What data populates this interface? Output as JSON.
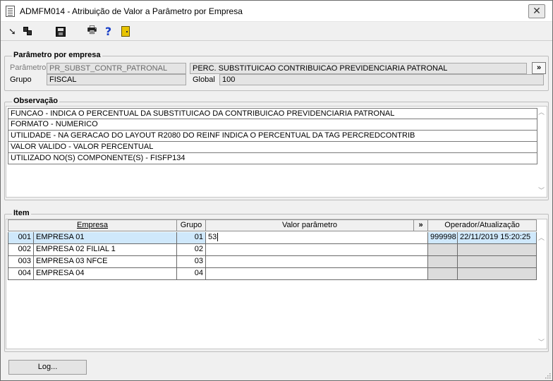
{
  "window": {
    "title": "ADMFM014 - Atribuição de Valor a Parâmetro por Empresa",
    "close_label": "✕"
  },
  "toolbar": {
    "icons": [
      "arrow-icon",
      "copy-icon",
      "save-icon",
      "print-icon",
      "help-icon",
      "exit-icon"
    ],
    "help_glyph": "?"
  },
  "parametro_grupo": {
    "legend": "Parâmetro por empresa",
    "parametro_label": "Parâmetro",
    "parametro_code": "PR_SUBST_CONTR_PATRONAL",
    "parametro_desc": "PERC. SUBSTITUICAO CONTRIBUICAO PREVIDENCIARIA PATRONAL",
    "more_label": "»",
    "grupo_label": "Grupo",
    "grupo_value": "FISCAL",
    "global_label": "Global",
    "global_value": "100"
  },
  "observacao": {
    "legend": "Observação",
    "lines": [
      "FUNCAO - INDICA O PERCENTUAL DA SUBSTITUICAO DA CONTRIBUICAO PREVIDENCIARIA PATRONAL",
      "FORMATO - NUMERICO",
      "UTILIDADE -  NA GERACAO DO LAYOUT R2080 DO REINF INDICA O PERCENTUAL DA TAG PERCREDCONTRIB",
      "VALOR VALIDO - VALOR PERCENTUAL",
      "UTILIZADO NO(S) COMPONENTE(S) - FISFP134"
    ]
  },
  "item": {
    "legend": "Item",
    "headers": {
      "empresa": "Empresa",
      "grupo": "Grupo",
      "valor": "Valor parâmetro",
      "more": "»",
      "operador": "Operador/Atualização"
    },
    "rows": [
      {
        "code": "001",
        "name": "EMPRESA 01",
        "grupo": "01",
        "valor": "53",
        "operador": "999998",
        "atualizacao": "22/11/2019 15:20:25"
      },
      {
        "code": "002",
        "name": "EMPRESA 02 FILIAL 1",
        "grupo": "02",
        "valor": "",
        "operador": "",
        "atualizacao": ""
      },
      {
        "code": "003",
        "name": "EMPRESA 03 NFCE",
        "grupo": "03",
        "valor": "",
        "operador": "",
        "atualizacao": ""
      },
      {
        "code": "004",
        "name": "EMPRESA 04",
        "grupo": "04",
        "valor": "",
        "operador": "",
        "atualizacao": ""
      }
    ]
  },
  "footer": {
    "log_label": "Log..."
  }
}
